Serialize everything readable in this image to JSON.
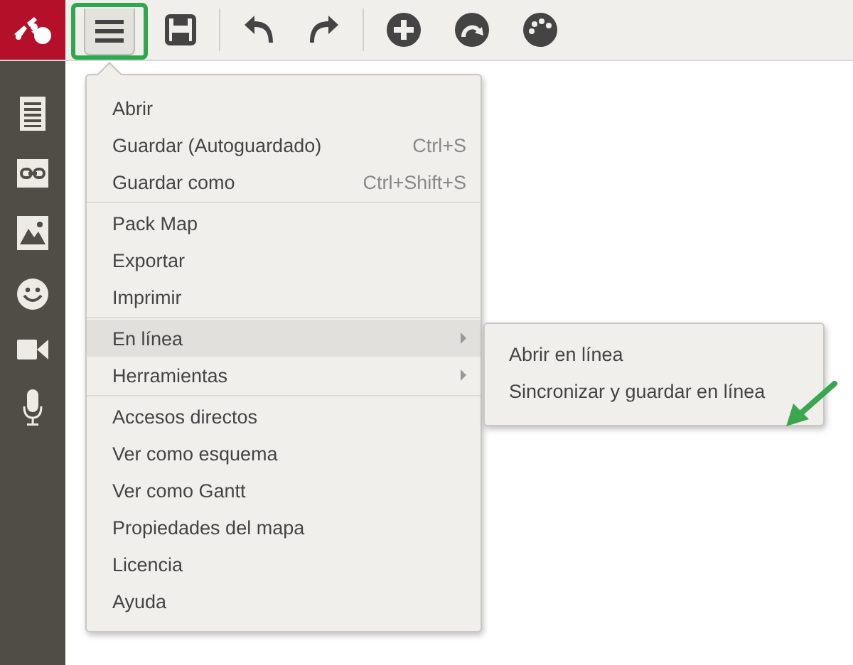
{
  "toolbar": {
    "menu_button": {
      "highlighted": true
    },
    "tools": [
      {
        "kind": "save"
      },
      {
        "kind": "separator"
      },
      {
        "kind": "undo"
      },
      {
        "kind": "redo"
      },
      {
        "kind": "separator"
      },
      {
        "kind": "add"
      },
      {
        "kind": "connect"
      },
      {
        "kind": "palette"
      }
    ]
  },
  "sidebar": {
    "items": [
      {
        "kind": "notes"
      },
      {
        "kind": "link"
      },
      {
        "kind": "image"
      },
      {
        "kind": "emoji"
      },
      {
        "kind": "video"
      },
      {
        "kind": "audio"
      }
    ]
  },
  "menu": {
    "groups": [
      {
        "items": [
          {
            "label": "Abrir",
            "selected": false,
            "has_submenu": false
          },
          {
            "label": "Guardar (Autoguardado)",
            "shortcut": "Ctrl+S",
            "selected": false,
            "has_submenu": false
          },
          {
            "label": "Guardar como",
            "shortcut": "Ctrl+Shift+S",
            "selected": false,
            "has_submenu": false
          }
        ]
      },
      {
        "items": [
          {
            "label": "Pack Map",
            "selected": false,
            "has_submenu": false
          },
          {
            "label": "Exportar",
            "selected": false,
            "has_submenu": false
          },
          {
            "label": "Imprimir",
            "selected": false,
            "has_submenu": false
          }
        ]
      },
      {
        "items": [
          {
            "label": "En línea",
            "selected": true,
            "has_submenu": true
          },
          {
            "label": "Herramientas",
            "selected": false,
            "has_submenu": true
          }
        ]
      },
      {
        "items": [
          {
            "label": "Accesos directos",
            "selected": false,
            "has_submenu": false
          },
          {
            "label": "Ver como esquema",
            "selected": false,
            "has_submenu": false
          },
          {
            "label": "Ver como Gantt",
            "selected": false,
            "has_submenu": false
          },
          {
            "label": "Propiedades del mapa",
            "selected": false,
            "has_submenu": false
          },
          {
            "label": "Licencia",
            "selected": false,
            "has_submenu": false
          },
          {
            "label": "Ayuda",
            "selected": false,
            "has_submenu": false
          }
        ]
      }
    ]
  },
  "submenu": {
    "items": [
      {
        "label": "Abrir en línea",
        "pointed_at": false
      },
      {
        "label": "Sincronizar y guardar en línea",
        "pointed_at": true
      }
    ]
  }
}
